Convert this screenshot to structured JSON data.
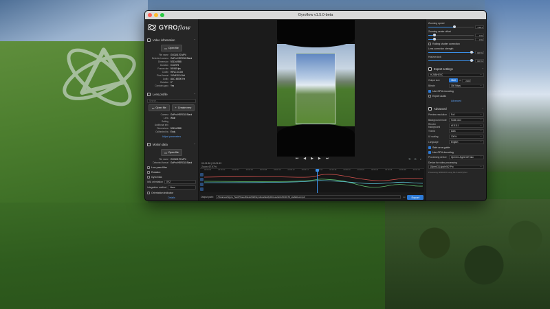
{
  "window": {
    "title": "Gyroflow v1.5.0-beta"
  },
  "brand": {
    "name": "GYRO",
    "suffix": "flow"
  },
  "video_info": {
    "header": "Video information",
    "open_button": "Open file",
    "rows": [
      {
        "k": "File name",
        "v": "GX010170.MP4"
      },
      {
        "k": "Detected camera",
        "v": "GoPro HERO11 Black"
      },
      {
        "k": "Dimension",
        "v": "5312x2988"
      },
      {
        "k": "Duration",
        "v": "0:16:976"
      },
      {
        "k": "Frame rate",
        "v": "59.940 fps"
      },
      {
        "k": "Codec",
        "v": "HEVC 10-bit"
      },
      {
        "k": "Pixel format",
        "v": "YUV420 10-bit"
      },
      {
        "k": "Audio",
        "v": "AAC 48000 Hz"
      },
      {
        "k": "Rotation",
        "v": "0°"
      },
      {
        "k": "Contains gyro",
        "v": "Yes"
      }
    ]
  },
  "lens_profile": {
    "header": "Lens profile",
    "search_placeholder": "Search...",
    "open_button": "Open file",
    "create_button": "Create new",
    "rows": [
      {
        "k": "Camera",
        "v": "GoPro HERO11 Black"
      },
      {
        "k": "Lens",
        "v": "Wide"
      },
      {
        "k": "Setting",
        "v": ""
      },
      {
        "k": "Additional info",
        "v": ""
      },
      {
        "k": "Dimensions",
        "v": "5312x2988"
      },
      {
        "k": "Calibrated by",
        "v": "Eddy"
      }
    ],
    "adjust_link": "Adjust parameters"
  },
  "motion_data": {
    "header": "Motion data",
    "open_button": "Open file",
    "rows": [
      {
        "k": "File name",
        "v": "GX010170.MP4"
      },
      {
        "k": "Detected format",
        "v": "GoPro HERO11 Black"
      }
    ],
    "checks": [
      {
        "label": "Low pass filter",
        "on": false
      },
      {
        "label": "Rotation",
        "on": false
      },
      {
        "label": "Gyro bias",
        "on": false
      }
    ],
    "imu_orientation_label": "IMU orientation",
    "imu_orientation_value": "XYZ",
    "integration_label": "Integration method",
    "integration_value": "None",
    "orientation_indicator": "Orientation indicator",
    "details_link": "Details"
  },
  "viewer": {
    "timecode": "00:01:38 | 00:01:53",
    "timecode_sub": "Zoom: 67.97%",
    "play_icon": "▶",
    "prev_icon": "⏮",
    "next_icon": "⏭",
    "step_back_icon": "◀",
    "step_fwd_icon": "▶",
    "tick_labels": [
      "00:00:00",
      "00:00:02",
      "00:00:04",
      "00:00:06",
      "00:00:08",
      "00:00:10",
      "00:00:12",
      "00:00:14",
      "00:00:16",
      "00:00:18",
      "00:00:20",
      "00:00:22",
      "00:00:24",
      "00:00:26",
      "00:00:28",
      "00:00:30"
    ]
  },
  "output": {
    "label": "Output path:",
    "path": "/Volumes/Ogyro_Test/Phone/Files/2023/Gyroflow/Eddy/01/results/GX010170_stabilized.mp4",
    "export_button": "Export"
  },
  "right_panel": {
    "sliders": [
      {
        "label": "Zooming speed",
        "value": "4.00 s",
        "pos": 0.55
      },
      {
        "label": "Zooming center offset",
        "value": "0 %",
        "pos": 0.1
      },
      {
        "label": "",
        "value": "0 %",
        "pos": 0.1
      }
    ],
    "rolling_shutter": "Rolling shutter correction",
    "lens_strength_label": "Lens correction strength",
    "lens_strength_value": "100 %",
    "horizon_label": "Horizon lock",
    "horizon_value": "100 %",
    "export_settings_header": "Export settings",
    "preset_value": "H.265/HEVC",
    "output_size_label": "Output size",
    "output_w": "3840",
    "output_h": "2160",
    "bitrate_label": "Bitrate",
    "bitrate_value": "150 Mbps",
    "use_gpu": "Use GPU encoding",
    "export_audio": "Export audio",
    "advanced_link": "Advanced",
    "advanced_header": "Advanced",
    "rows": [
      {
        "lab": "Preview resolution",
        "val": "Full"
      },
      {
        "lab": "Background mode",
        "val": "Solid color"
      },
      {
        "lab": "Render background",
        "val": "#111111"
      },
      {
        "lab": "Theme",
        "val": "Dark"
      },
      {
        "lab": "UI scaling",
        "val": "100%"
      },
      {
        "lab": "Language",
        "val": "English"
      }
    ],
    "safe_area": "Safe area guide",
    "gpu_decoding": "Use GPU decoding",
    "processing_label": "Processing device",
    "processing_value": "OpenCL Apple M2 Max",
    "device_label": "Device for video processing",
    "device_value": "[OpenCL] Apple M2 Pro",
    "footer": "Processing SIMD/AVX using MLX and Python"
  }
}
